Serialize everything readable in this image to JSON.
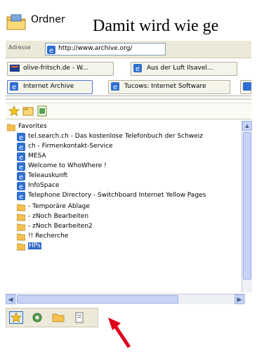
{
  "heading": {
    "folder_label": "Ordner",
    "sentence": "Damit wird wie ge"
  },
  "address": {
    "label": "Adresse",
    "url": "http://www.archive.org/"
  },
  "links_row1": [
    {
      "label": "olive-fritsch.de - W...",
      "icon": "page-icon"
    },
    {
      "label": "Aus der Luft Ilsavel...",
      "icon": "ie-icon"
    }
  ],
  "links_row2": [
    {
      "label": "Internet Archive",
      "icon": "ie-icon"
    },
    {
      "label": "Tucows: Internet Software",
      "icon": "ie-icon"
    }
  ],
  "favorites_tree": {
    "root": "Favorites",
    "items": [
      {
        "label": "tel.search.ch - Das kostenlose Telefonbuch der Schweiz",
        "icon": "ie-icon"
      },
      {
        "label": "ch - Firmenkontakt-Service",
        "icon": "ie-icon"
      },
      {
        "label": "MESA",
        "icon": "ie-icon"
      },
      {
        "label": "Welcome to WhoWhere !",
        "icon": "ie-icon"
      },
      {
        "label": "Teleauskunft",
        "icon": "ie-icon"
      },
      {
        "label": "InfoSpace",
        "icon": "ie-icon"
      },
      {
        "label": "Telephone Directory - Switchboard Internet Yellow Pages",
        "icon": "ie-icon"
      },
      {
        "label": "- Temporäre Ablage",
        "icon": "folder-icon",
        "prefix": "-"
      },
      {
        "label": "- zNoch Bearbeiten",
        "icon": "folder-icon",
        "prefix": "-"
      },
      {
        "label": "- zNoch Bearbeiten2",
        "icon": "folder-icon",
        "prefix": "-"
      },
      {
        "label": "!! Recherche",
        "icon": "folder-icon"
      },
      {
        "label": "HPs",
        "icon": "folder-icon",
        "selected": true
      }
    ]
  },
  "colors": {
    "selection": "#316ac5",
    "scroll": "#c6d3f7",
    "annotation_arrow": "#e0001a"
  }
}
